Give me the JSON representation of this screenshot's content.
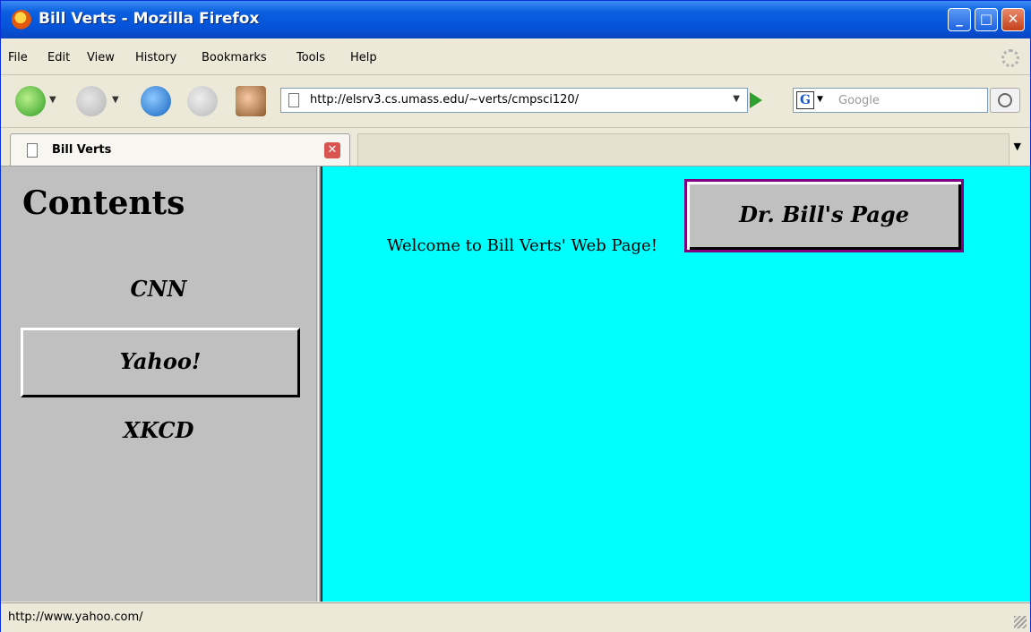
{
  "window": {
    "title": "Bill Verts - Mozilla Firefox"
  },
  "menu": [
    "File",
    "Edit",
    "View",
    "History",
    "Bookmarks",
    "Tools",
    "Help"
  ],
  "nav": {
    "url": "http://elsrv3.cs.umass.edu/~verts/cmpsci120/",
    "search_placeholder": "Google",
    "search_engine_letter": "G"
  },
  "tab": {
    "label": "Bill Verts"
  },
  "left_frame": {
    "heading": "Contents",
    "links": [
      "CNN",
      "Yahoo!",
      "XKCD"
    ]
  },
  "right_frame": {
    "welcome": "Welcome to Bill Verts' Web Page!",
    "button_label": "Dr. Bill's Page",
    "background": "#00ffff"
  },
  "status": {
    "text": "http://www.yahoo.com/"
  }
}
